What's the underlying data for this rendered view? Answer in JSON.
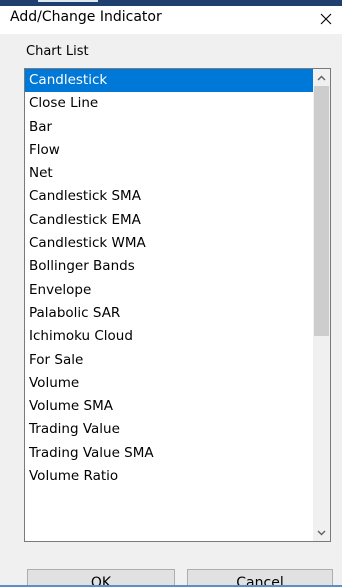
{
  "window": {
    "title": "Add/Change Indicator",
    "accent_color": "#0078d7"
  },
  "icons": {
    "close": "close-icon",
    "scroll_up": "chevron-up-icon",
    "scroll_down": "chevron-down-icon"
  },
  "chart_list": {
    "label": "Chart List",
    "selected_index": 0,
    "items": [
      "Candlestick",
      "Close Line",
      "Bar",
      "Flow",
      "Net",
      "Candlestick SMA",
      "Candlestick EMA",
      "Candlestick WMA",
      "Bollinger Bands",
      "Envelope",
      "Palabolic SAR",
      "Ichimoku Cloud",
      "For Sale",
      "Volume",
      "Volume SMA",
      "Trading Value",
      "Trading Value SMA",
      "Volume Ratio",
      ""
    ]
  },
  "buttons": {
    "ok_label": "OK",
    "cancel_label": "Cancel"
  }
}
